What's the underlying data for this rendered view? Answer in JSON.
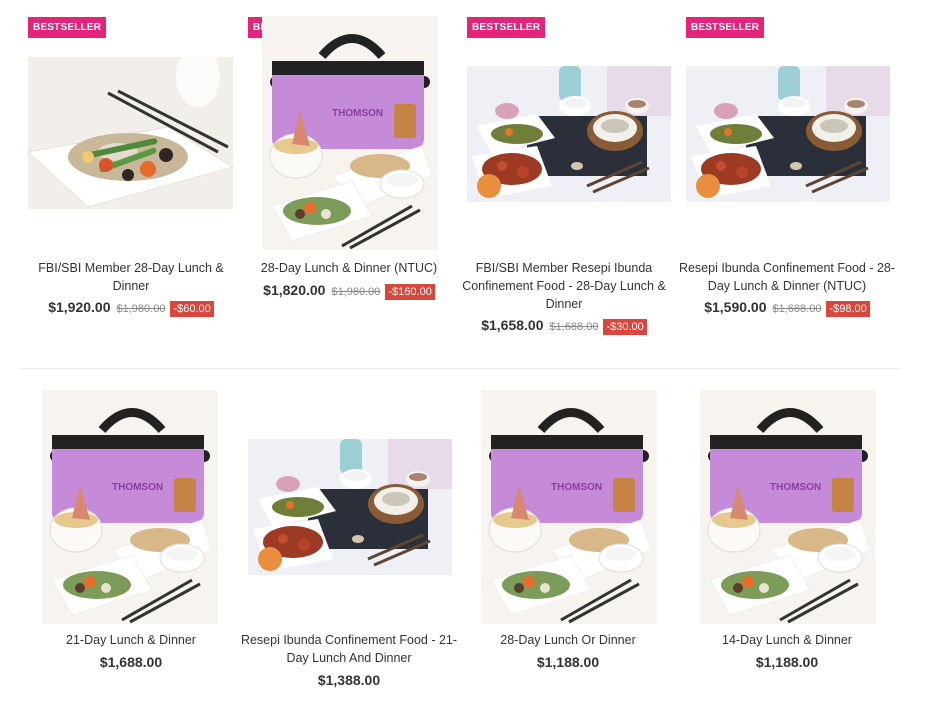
{
  "products": [
    {
      "badge": "BESTSELLER",
      "name": "FBI/SBI Member 28-Day Lunch & Dinner",
      "price": "$1,920.00",
      "old_price": "$1,980.00",
      "discount": "-$60.00"
    },
    {
      "badge": "BESTSELLER",
      "name": "28-Day Lunch & Dinner (NTUC)",
      "price": "$1,820.00",
      "old_price": "$1,980.00",
      "discount": "-$160.00"
    },
    {
      "badge": "BESTSELLER",
      "name": "FBI/SBI Member Resepi Ibunda Confinement Food - 28-Day Lunch & Dinner",
      "price": "$1,658.00",
      "old_price": "$1,688.00",
      "discount": "-$30.00"
    },
    {
      "badge": "BESTSELLER",
      "name": "Resepi Ibunda Confinement Food - 28-Day Lunch & Dinner (NTUC)",
      "price": "$1,590.00",
      "old_price": "$1,688.00",
      "discount": "-$98.00"
    },
    {
      "name": "21-Day Lunch & Dinner",
      "price": "$1,688.00"
    },
    {
      "name": "Resepi Ibunda Confinement Food - 21-Day Lunch And Dinner",
      "price": "$1,388.00"
    },
    {
      "name": "28-Day Lunch Or Dinner",
      "price": "$1,188.00"
    },
    {
      "name": "14-Day Lunch & Dinner",
      "price": "$1,188.00"
    }
  ],
  "colors": {
    "badge": "#e4247b",
    "discount": "#d9463b",
    "bag": "#c58ad8"
  },
  "image_names": [
    "stir-fry-dish-photo",
    "thomson-bag-meal-photo",
    "resepi-ibunda-meal-photo",
    "resepi-ibunda-meal-photo",
    "thomson-bag-meal-photo",
    "resepi-ibunda-meal-photo",
    "thomson-bag-meal-photo",
    "thomson-bag-meal-photo"
  ]
}
